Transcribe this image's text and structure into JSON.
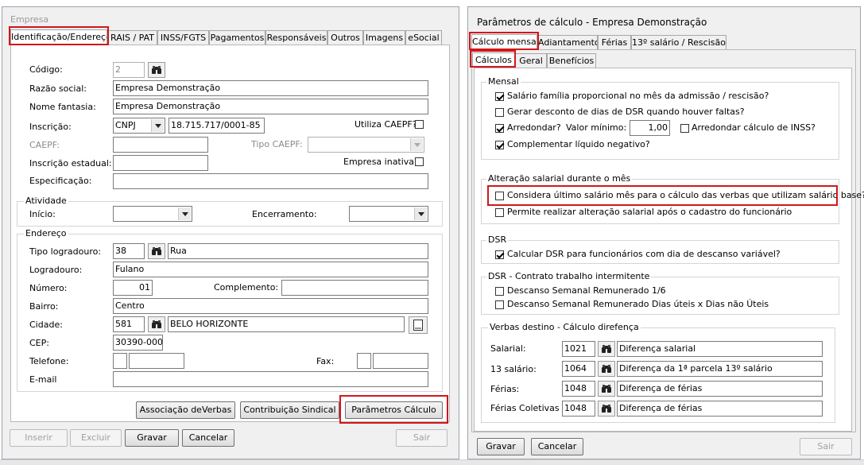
{
  "left_window": {
    "title": "Empresa",
    "tabs": [
      "Identificação/Endereço",
      "RAIS / PAT",
      "INSS/FGTS",
      "Pagamentos",
      "Responsáveis",
      "Outros",
      "Imagens",
      "eSocial"
    ],
    "fields": {
      "codigo": {
        "label": "Código:",
        "value": "2"
      },
      "razao_social": {
        "label": "Razão social:",
        "value": "Empresa Demonstração"
      },
      "nome_fantasia": {
        "label": "Nome fantasia:",
        "value": "Empresa Demonstração"
      },
      "inscricao": {
        "label": "Inscrição:",
        "type": "CNPJ",
        "value": "18.715.717/0001-85"
      },
      "utiliza_caepf": {
        "label": "Utiliza CAEPF?",
        "checked": false
      },
      "caepf": {
        "label": "CAEPF:",
        "value": ""
      },
      "tipo_caepf": {
        "label": "Tipo CAEPF:",
        "value": ""
      },
      "inscricao_estadual": {
        "label": "Inscrição estadual:",
        "value": ""
      },
      "empresa_inativa": {
        "label": "Empresa inativa?",
        "checked": false
      },
      "especificacao": {
        "label": "Especificação:",
        "value": ""
      }
    },
    "atividade": {
      "caption": "Atividade",
      "inicio_label": "Início:",
      "encerramento_label": "Encerramento:"
    },
    "endereco": {
      "caption": "Endereço",
      "tipo_logradouro": {
        "label": "Tipo logradouro:",
        "code": "38",
        "value": "Rua"
      },
      "logradouro": {
        "label": "Logradouro:",
        "value": "Fulano"
      },
      "numero": {
        "label": "Número:",
        "value": "01"
      },
      "complemento": {
        "label": "Complemento:",
        "value": ""
      },
      "bairro": {
        "label": "Bairro:",
        "value": "Centro"
      },
      "cidade": {
        "label": "Cidade:",
        "code": "581",
        "value": "BELO HORIZONTE"
      },
      "cep": {
        "label": "CEP:",
        "value": "30390-000"
      },
      "telefone": {
        "label": "Telefone:"
      },
      "fax": {
        "label": "Fax:"
      },
      "email": {
        "label": "E-mail",
        "value": ""
      }
    },
    "buttons": {
      "associacao": "Associação deVerbas",
      "contribuicao": "Contribuição Sindical",
      "parametros": "Parâmetros Cálculo",
      "inserir": "Inserir",
      "excluir": "Excluir",
      "gravar": "Gravar",
      "cancelar": "Cancelar",
      "sair": "Sair"
    }
  },
  "right_window": {
    "title": "Parâmetros de cálculo  - Empresa Demonstração",
    "tabs": [
      "Cálculo mensal",
      "Adiantamento",
      "Férias",
      "13º salário / Rescisão"
    ],
    "subtabs": [
      "Cálculos",
      "Geral",
      "Benefícios"
    ],
    "mensal": {
      "caption": "Mensal",
      "salario_familia": {
        "label": "Salário família proporcional no mês da admissão / rescisão?",
        "checked": true
      },
      "gerar_desconto": {
        "label": "Gerar desconto de dias de DSR quando houver faltas?",
        "checked": false
      },
      "arredondar": {
        "label": "Arredondar?",
        "checked": true
      },
      "valor_minimo_label": "Valor mínimo:",
      "valor_minimo": "1,00",
      "arredondar_inss": {
        "label": "Arredondar cálculo de INSS?",
        "checked": false
      },
      "complementar": {
        "label": "Complementar líquido negativo?",
        "checked": true
      }
    },
    "alteracao": {
      "caption": "Alteração salarial durante o mês",
      "considera": {
        "label": "Considera último salário mês para o cálculo das verbas que utilizam salário base?",
        "checked": false
      },
      "permite": {
        "label": "Permite realizar alteração salarial após o cadastro do funcionário",
        "checked": false
      }
    },
    "dsr": {
      "caption": "DSR",
      "calcular": {
        "label": "Calcular DSR para funcionários com dia de descanso variável?",
        "checked": true
      }
    },
    "dsr_intermitente": {
      "caption": "DSR - Contrato trabalho intermitente",
      "remunerado": {
        "label": "Descanso Semanal Remunerado 1/6",
        "checked": false
      },
      "dias_uteis": {
        "label": "Descanso Semanal Remunerado Dias úteis x Dias não Úteis",
        "checked": false
      }
    },
    "verbas": {
      "caption": "Verbas destino - Cálculo direfença",
      "rows": [
        {
          "label": "Salarial:",
          "code": "1021",
          "desc": "Diferença salarial"
        },
        {
          "label": "13 salário:",
          "code": "1064",
          "desc": "Diferença  da 1ª parcela 13º salário"
        },
        {
          "label": "Férias:",
          "code": "1048",
          "desc": "Diferença de férias"
        },
        {
          "label": "Férias Coletivas :",
          "code": "1048",
          "desc": "Diferença de férias"
        }
      ]
    },
    "buttons": {
      "gravar": "Gravar",
      "cancelar": "Cancelar",
      "sair": "Sair"
    }
  },
  "colors": {
    "highlight": "#d0171b",
    "window_bg": "#f0f0f0"
  },
  "icons": [
    "binoculars-icon",
    "calendar-icon",
    "dropdown-arrow-icon",
    "checkbox-icon"
  ]
}
